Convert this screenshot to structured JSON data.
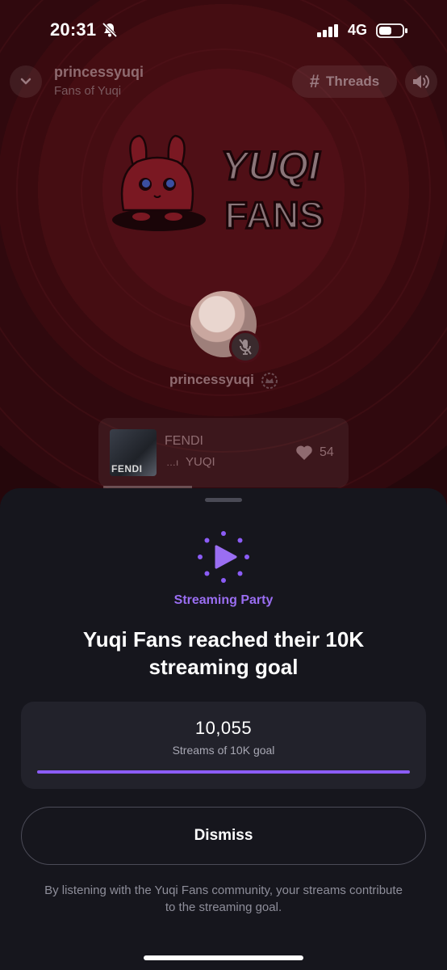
{
  "status_bar": {
    "time": "20:31",
    "network": "4G",
    "icons": [
      "bell-slash-icon",
      "signal-icon",
      "battery-icon"
    ]
  },
  "header": {
    "title": "princessyuqi",
    "subtitle": "Fans of Yuqi",
    "threads_label": "Threads"
  },
  "logo": {
    "line1": "YUQI",
    "line2": "FANS"
  },
  "host": {
    "name": "princessyuqi"
  },
  "now_playing": {
    "title": "FENDI",
    "artist": "YUQI",
    "art_label": "FENDI",
    "likes": "54"
  },
  "sheet": {
    "label": "Streaming Party",
    "headline": "Yuqi Fans reached their 10K streaming goal",
    "goal": {
      "count": "10,055",
      "caption": "Streams of 10K goal",
      "progress_fraction": 1.0
    },
    "dismiss_label": "Dismiss",
    "footnote": "By listening with the Yuqi Fans community, your streams contribute to the streaming goal."
  },
  "colors": {
    "accent": "#8b5cf6",
    "accent_text": "#9a6ef2",
    "background_red": "#4a0e16",
    "sheet_bg": "#16161d"
  }
}
